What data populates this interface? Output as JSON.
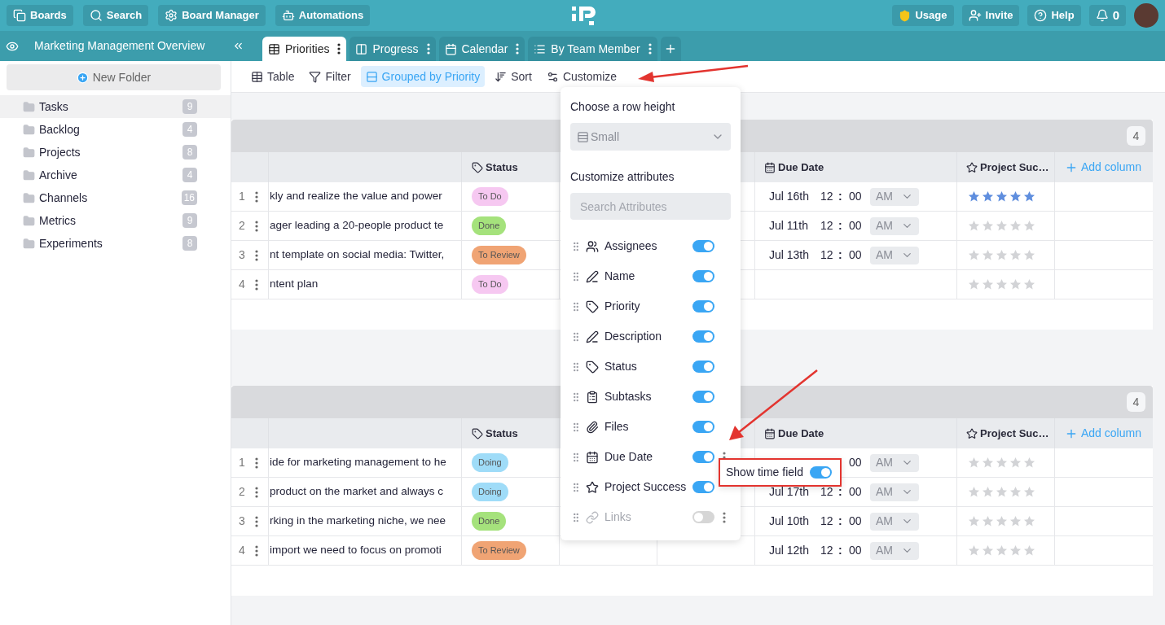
{
  "top_nav": [
    {
      "label": "Boards"
    },
    {
      "label": "Search"
    },
    {
      "label": "Board Manager"
    },
    {
      "label": "Automations"
    }
  ],
  "account_menu": [
    {
      "label": "Usage"
    },
    {
      "label": "Invite"
    },
    {
      "label": "Help"
    },
    {
      "label": "0"
    }
  ],
  "board_title": "Marketing Management Overview",
  "views": [
    {
      "label": "Priorities",
      "selected": true
    },
    {
      "label": "Progress",
      "selected": false
    },
    {
      "label": "Calendar",
      "selected": false
    },
    {
      "label": "By Team Member",
      "selected": false
    }
  ],
  "sidebar": {
    "new_folder": "New Folder",
    "folders": [
      {
        "name": "Tasks",
        "count": "9",
        "selected": true
      },
      {
        "name": "Backlog",
        "count": "4",
        "selected": false
      },
      {
        "name": "Projects",
        "count": "8",
        "selected": false
      },
      {
        "name": "Archive",
        "count": "4",
        "selected": false
      },
      {
        "name": "Channels",
        "count": "16",
        "selected": false
      },
      {
        "name": "Metrics",
        "count": "9",
        "selected": false
      },
      {
        "name": "Experiments",
        "count": "8",
        "selected": false
      }
    ]
  },
  "toolbar": [
    {
      "label": "Table",
      "selected": false
    },
    {
      "label": "Filter",
      "selected": false
    },
    {
      "label": "Grouped by Priority",
      "selected": true
    },
    {
      "label": "Sort",
      "selected": false
    },
    {
      "label": "Customize",
      "selected": false
    }
  ],
  "groups": [
    {
      "count": "4",
      "status_column": "Status",
      "due_date_column": "Due Date",
      "rating_column": "Project Suc…",
      "add_column": "Add column",
      "rows": [
        {
          "number": "1",
          "name": "kly and realize the value and power",
          "status": {
            "label": "To Do",
            "color": "#f6c8f1"
          },
          "due": {
            "date": "Jul 16th",
            "hour": "12",
            "separator": ":",
            "minute": "00",
            "meridiem": "AM"
          },
          "stars": 5
        },
        {
          "number": "2",
          "name": "ager leading a 20-people product te",
          "status": {
            "label": "Done",
            "color": "#a5e27c"
          },
          "due": {
            "date": "Jul 11th",
            "hour": "12",
            "separator": ":",
            "minute": "00",
            "meridiem": "AM"
          },
          "stars": 0
        },
        {
          "number": "3",
          "name": "nt template on social media: Twitter,",
          "status": {
            "label": "To Review",
            "color": "#f0a474"
          },
          "due": {
            "date": "Jul 13th",
            "hour": "12",
            "separator": ":",
            "minute": "00",
            "meridiem": "AM"
          },
          "stars": 0
        },
        {
          "number": "4",
          "name": "ntent plan",
          "status": {
            "label": "To Do",
            "color": "#f6c8f1"
          },
          "stars": 0
        }
      ]
    },
    {
      "count": "4",
      "status_column": "Status",
      "due_date_column": "Due Date",
      "rating_column": "Project Suc…",
      "add_column": "Add column",
      "rows": [
        {
          "number": "1",
          "name": "ide for marketing management to he",
          "status": {
            "label": "Doing",
            "color": "#9fdcf8"
          },
          "due": {
            "minute": "00",
            "meridiem": "AM"
          },
          "stars": 0
        },
        {
          "number": "2",
          "name": "product on the market and always c",
          "status": {
            "label": "Doing",
            "color": "#9fdcf8"
          },
          "due": {
            "date": "Jul 17th",
            "hour": "12",
            "separator": ":",
            "minute": "00",
            "meridiem": "AM"
          },
          "stars": 0
        },
        {
          "number": "3",
          "name": "rking in the marketing niche, we nee",
          "status": {
            "label": "Done",
            "color": "#a5e27c"
          },
          "due": {
            "date": "Jul 10th",
            "hour": "12",
            "separator": ":",
            "minute": "00",
            "meridiem": "AM"
          },
          "stars": 0
        },
        {
          "number": "4",
          "name": "import we need to focus on promoti",
          "status": {
            "label": "To Review",
            "color": "#f0a474"
          },
          "due": {
            "date": "Jul 12th",
            "hour": "12",
            "separator": ":",
            "minute": "00",
            "meridiem": "AM"
          },
          "stars": 0
        }
      ]
    }
  ],
  "customize_panel": {
    "row_height_title": "Choose a row height",
    "row_height": "Small",
    "attributes_title": "Customize attributes",
    "search_placeholder": "Search Attributes",
    "attributes": [
      {
        "label": "Assignees",
        "on": true,
        "disabled": false,
        "has_menu": false
      },
      {
        "label": "Name",
        "on": true,
        "disabled": false,
        "has_menu": false
      },
      {
        "label": "Priority",
        "on": true,
        "disabled": false,
        "has_menu": false
      },
      {
        "label": "Description",
        "on": true,
        "disabled": false,
        "has_menu": false
      },
      {
        "label": "Status",
        "on": true,
        "disabled": false,
        "has_menu": false
      },
      {
        "label": "Subtasks",
        "on": true,
        "disabled": false,
        "has_menu": false
      },
      {
        "label": "Files",
        "on": true,
        "disabled": false,
        "has_menu": false
      },
      {
        "label": "Due Date",
        "on": true,
        "disabled": false,
        "has_menu": true
      },
      {
        "label": "Project Success",
        "on": true,
        "disabled": false,
        "has_menu": false
      },
      {
        "label": "Links",
        "on": false,
        "disabled": true,
        "has_menu": true
      }
    ]
  },
  "time_field_popup": {
    "label": "Show time field",
    "on": true
  }
}
